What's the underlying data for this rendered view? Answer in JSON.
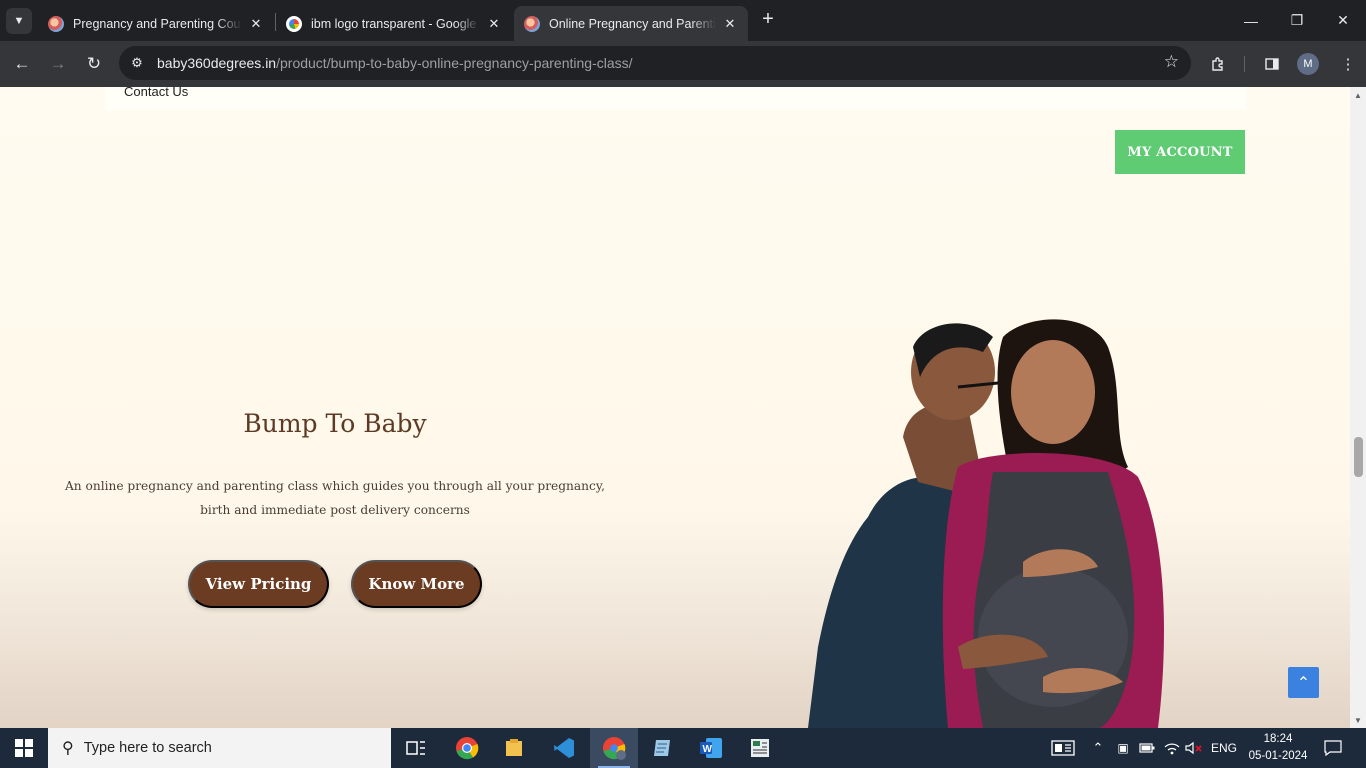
{
  "browser": {
    "tabs": [
      {
        "title": "Pregnancy and Parenting Courses",
        "favicon": "baby360-favicon"
      },
      {
        "title": "ibm logo transparent - Google Search",
        "favicon": "google-favicon"
      },
      {
        "title": "Online Pregnancy and Parenting Class",
        "favicon": "baby360-favicon",
        "active": true
      }
    ],
    "url_host": "baby360degrees.in",
    "url_path": "/product/bump-to-baby-online-pregnancy-parenting-class/",
    "profile_initial": "M"
  },
  "page": {
    "nav_contact": "Contact Us",
    "my_account": "MY ACCOUNT",
    "hero": {
      "title": "Bump To Baby",
      "description": "An online pregnancy and parenting class which guides you through all your pregnancy, birth and immediate post delivery concerns",
      "primary_button": "View Pricing",
      "secondary_button": "Know More"
    },
    "colors": {
      "accent_green": "#5fcb73",
      "brand_brown": "#6b3b22",
      "title_brown": "#5c3a24",
      "back_to_top_blue": "#3b82e0"
    }
  },
  "taskbar": {
    "search_placeholder": "Type here to search",
    "language": "ENG",
    "time": "18:24",
    "date": "05-01-2024"
  }
}
